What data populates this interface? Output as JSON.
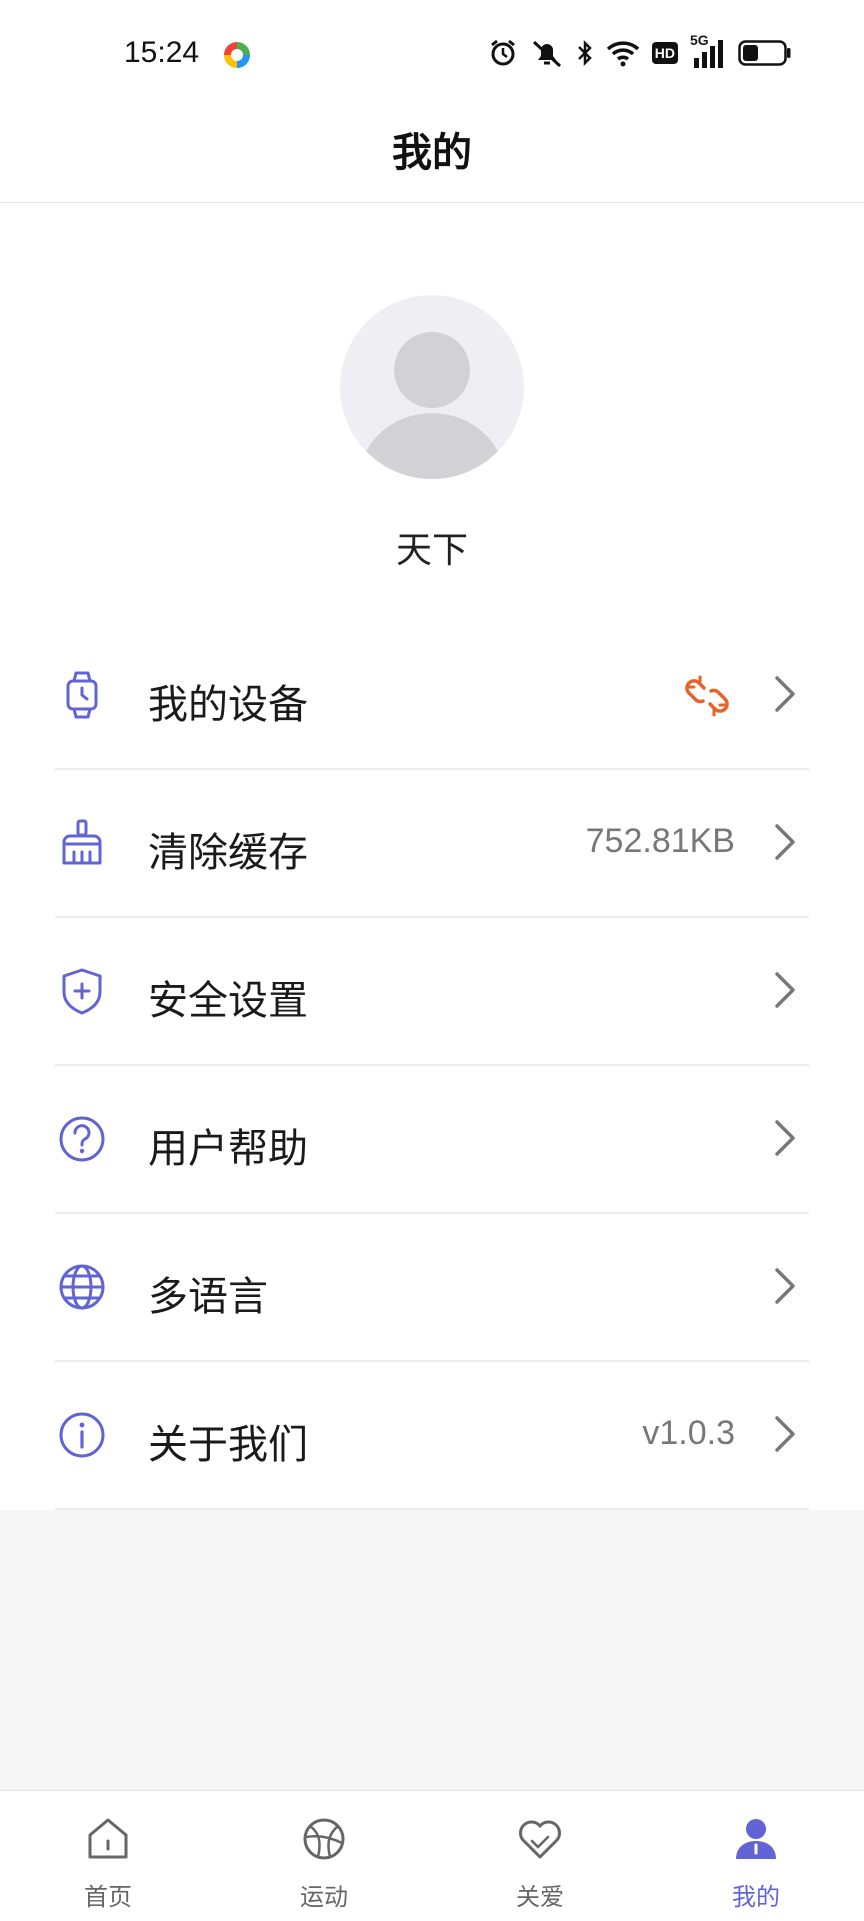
{
  "status_bar": {
    "time": "15:24",
    "network": "5G",
    "hd": "HD"
  },
  "header": {
    "title": "我的"
  },
  "profile": {
    "username": "天下"
  },
  "menu": {
    "items": [
      {
        "label": "我的设备",
        "icon": "watch-icon",
        "value": "",
        "status_icon": "broken-link-icon"
      },
      {
        "label": "清除缓存",
        "icon": "broom-icon",
        "value": "752.81KB"
      },
      {
        "label": "安全设置",
        "icon": "shield-plus-icon",
        "value": ""
      },
      {
        "label": "用户帮助",
        "icon": "help-circle-icon",
        "value": ""
      },
      {
        "label": "多语言",
        "icon": "globe-icon",
        "value": ""
      },
      {
        "label": "关于我们",
        "icon": "info-circle-icon",
        "value": "v1.0.3"
      }
    ]
  },
  "tabbar": {
    "tabs": [
      {
        "label": "首页",
        "icon": "home-icon",
        "active": false
      },
      {
        "label": "运动",
        "icon": "sports-ball-icon",
        "active": false
      },
      {
        "label": "关爱",
        "icon": "heart-icon",
        "active": false
      },
      {
        "label": "我的",
        "icon": "user-icon",
        "active": true
      }
    ]
  },
  "colors": {
    "accent": "#6264d6",
    "warning": "#e8622a",
    "background": "#f6f6f7",
    "icon_gray": "#666666"
  }
}
